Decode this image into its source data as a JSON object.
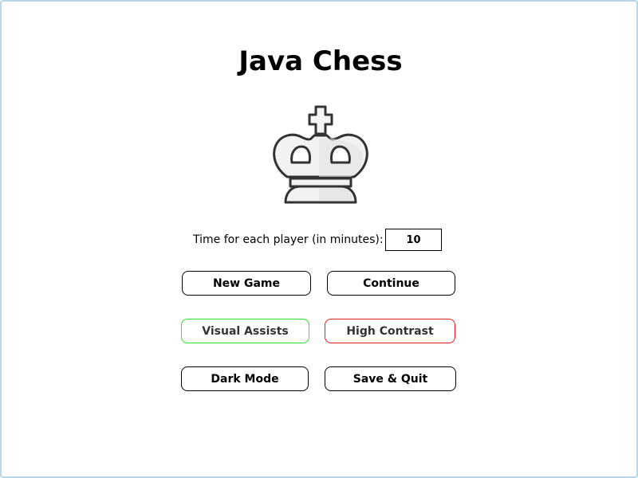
{
  "window": {
    "title": "Java Chess"
  },
  "logo": {
    "icon": "white-king-chess-piece"
  },
  "timer": {
    "label": "Time for each player (in minutes):",
    "value": "10"
  },
  "buttons": {
    "new_game": "New Game",
    "continue": "Continue",
    "visual_assists": "Visual Assists",
    "high_contrast": "High Contrast",
    "dark_mode": "Dark Mode",
    "save_quit": "Save & Quit"
  },
  "colors": {
    "window_border": "#b8d6ea",
    "visual_assists_border": "#2ee02e",
    "high_contrast_border": "#e01e1e",
    "button_border": "#000000",
    "background": "#ffffff"
  }
}
